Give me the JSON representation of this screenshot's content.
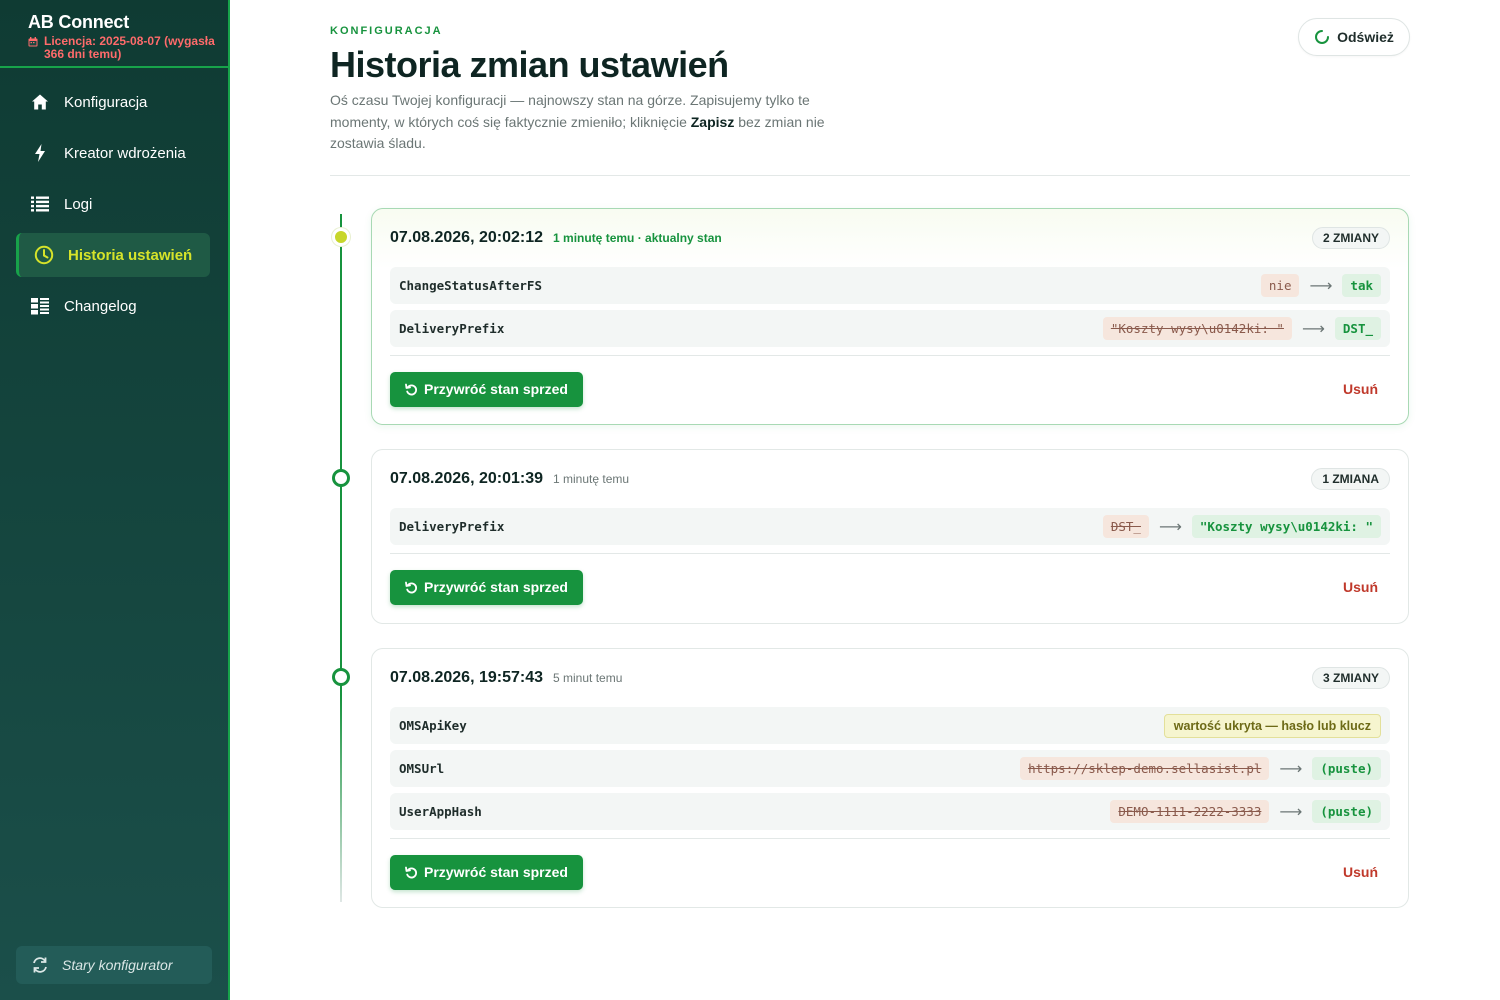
{
  "app": {
    "title": "AB Connect",
    "license": "Licencja: 2025-08-07 (wygasła 366 dni temu)"
  },
  "sidebar": {
    "items": [
      {
        "label": "Konfiguracja",
        "icon": "home-icon"
      },
      {
        "label": "Kreator wdrożenia",
        "icon": "bolt-icon"
      },
      {
        "label": "Logi",
        "icon": "list-icon"
      },
      {
        "label": "Historia ustawień",
        "icon": "clock-icon",
        "active": true
      },
      {
        "label": "Changelog",
        "icon": "changelog-icon"
      }
    ],
    "old_config": "Stary konfigurator"
  },
  "header": {
    "eyebrow": "KONFIGURACJA",
    "title": "Historia zmian ustawień",
    "intro_1": "Oś czasu Twojej konfiguracji — najnowszy stan na górze. Zapisujemy tylko te momenty, w których coś się faktycznie zmieniło; kliknięcie ",
    "intro_bold": "Zapisz",
    "intro_2": " bez zmian nie zostawia śladu.",
    "refresh_label": "Odśwież"
  },
  "entries": [
    {
      "date": "07.08.2026, 20:02:12",
      "relative": "1 minutę temu · aktualny stan",
      "badge": "2 ZMIANY",
      "changes": [
        {
          "field": "ChangeStatusAfterFS",
          "old": "nie",
          "new": "tak"
        },
        {
          "field": "DeliveryPrefix",
          "old": "\"Koszty wysy\\u0142ki: \"",
          "new": "DST_"
        }
      ],
      "restore_label": "Przywróć stan sprzed",
      "delete_label": "Usuń"
    },
    {
      "date": "07.08.2026, 20:01:39",
      "relative": "1 minutę temu",
      "badge": "1 ZMIANA",
      "changes": [
        {
          "field": "DeliveryPrefix",
          "old": "DST_",
          "new": "\"Koszty wysy\\u0142ki: \""
        }
      ],
      "restore_label": "Przywróć stan sprzed",
      "delete_label": "Usuń"
    },
    {
      "date": "07.08.2026, 19:57:43",
      "relative": "5 minut temu",
      "badge": "3 ZMIANY",
      "changes": [
        {
          "field": "OMSApiKey",
          "hidden": "wartość ukryta — hasło lub klucz"
        },
        {
          "field": "OMSUrl",
          "old": "https://sklep-demo.sellasist.pl",
          "new": "(puste)"
        },
        {
          "field": "UserAppHash",
          "old": "DEMO-1111-2222-3333",
          "new": "(puste)"
        }
      ],
      "restore_label": "Przywróć stan sprzed",
      "delete_label": "Usuń"
    }
  ]
}
